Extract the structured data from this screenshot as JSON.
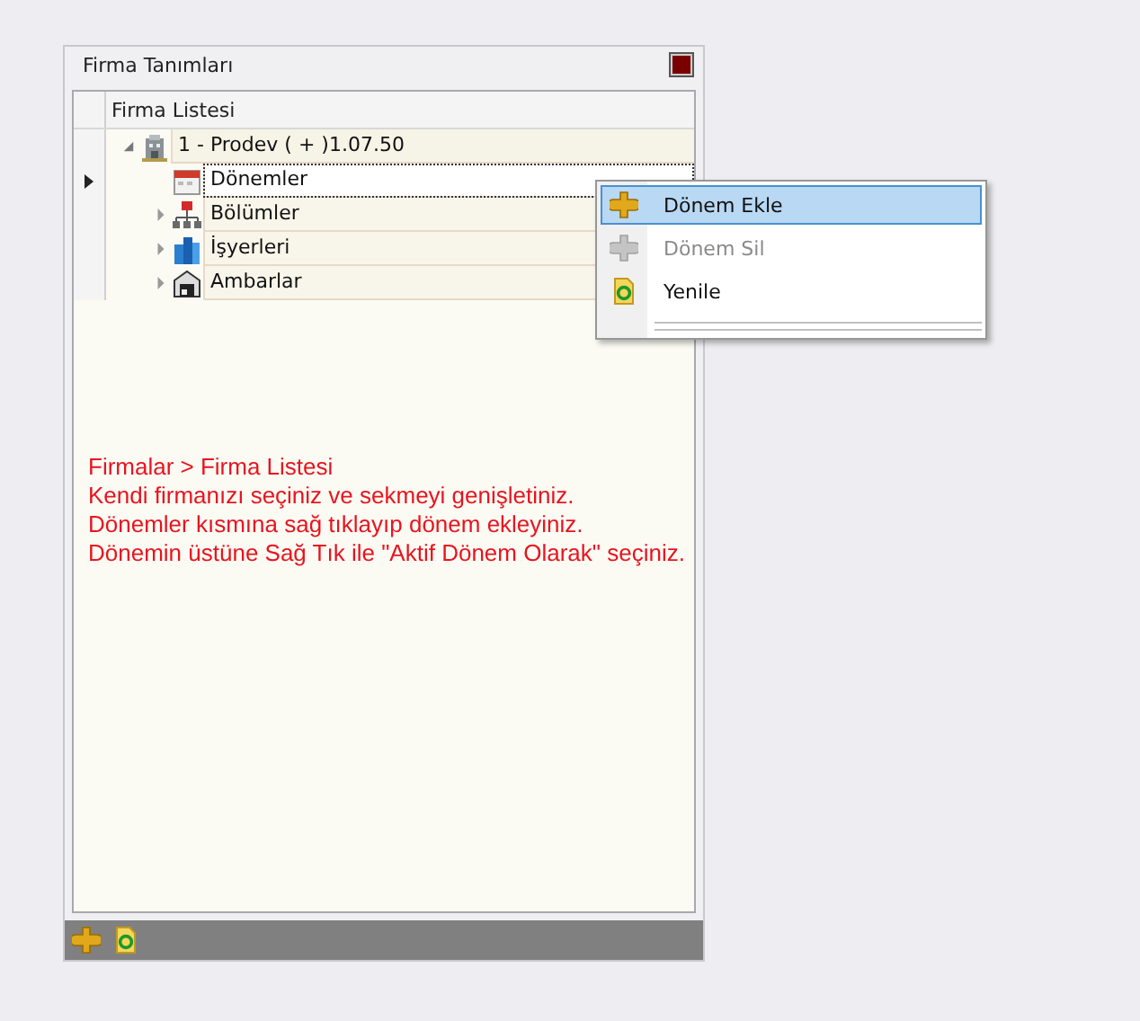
{
  "panel": {
    "title": "Firma Tanımları"
  },
  "tree": {
    "column": "Firma Listesi",
    "nodes": [
      {
        "label": "1 - Prodev ( + )1.07.50",
        "expanded": true,
        "selected": false,
        "children": [
          {
            "label": "Dönemler",
            "selected": true
          },
          {
            "label": "Bölümler",
            "expanded": false,
            "selected": false
          },
          {
            "label": "İşyerleri",
            "expanded": false,
            "selected": false
          },
          {
            "label": "Ambarlar",
            "expanded": false,
            "selected": false
          }
        ]
      }
    ]
  },
  "context_menu": {
    "items": [
      {
        "label": "Dönem Ekle",
        "disabled": false,
        "selected": true
      },
      {
        "label": "Dönem Sil",
        "disabled": true,
        "selected": false
      },
      {
        "label": "Yenile",
        "disabled": false,
        "selected": false
      }
    ]
  },
  "instructions": [
    "Firmalar > Firma Listesi",
    "Kendi firmanızı seçiniz ve sekmeyi genişletiniz.",
    "Dönemler kısmına sağ tıklayıp dönem ekleyiniz.",
    "Dönemin üstüne Sağ Tık ile \"Aktif Dönem Olarak\" seçiniz."
  ]
}
